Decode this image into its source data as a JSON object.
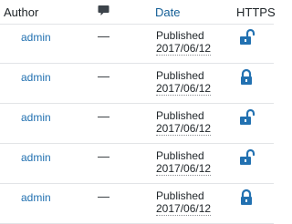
{
  "header": {
    "author": "Author",
    "comments_icon": "comment-bubble-icon",
    "date": "Date",
    "https": "HTTPS"
  },
  "rows": [
    {
      "author": "admin",
      "comments": "—",
      "status": "Published",
      "date": "2017/06/12",
      "https_icon": "unlocked-padlock-icon"
    },
    {
      "author": "admin",
      "comments": "—",
      "status": "Published",
      "date": "2017/06/12",
      "https_icon": "locked-padlock-icon"
    },
    {
      "author": "admin",
      "comments": "—",
      "status": "Published",
      "date": "2017/06/12",
      "https_icon": "unlocked-padlock-icon"
    },
    {
      "author": "admin",
      "comments": "—",
      "status": "Published",
      "date": "2017/06/12",
      "https_icon": "unlocked-padlock-icon"
    },
    {
      "author": "admin",
      "comments": "—",
      "status": "Published",
      "date": "2017/06/12",
      "https_icon": "locked-padlock-icon"
    }
  ],
  "colors": {
    "link": "#2271b1",
    "lock": "#2271b1",
    "text": "#1d2327",
    "divider": "#e2e4e7"
  }
}
